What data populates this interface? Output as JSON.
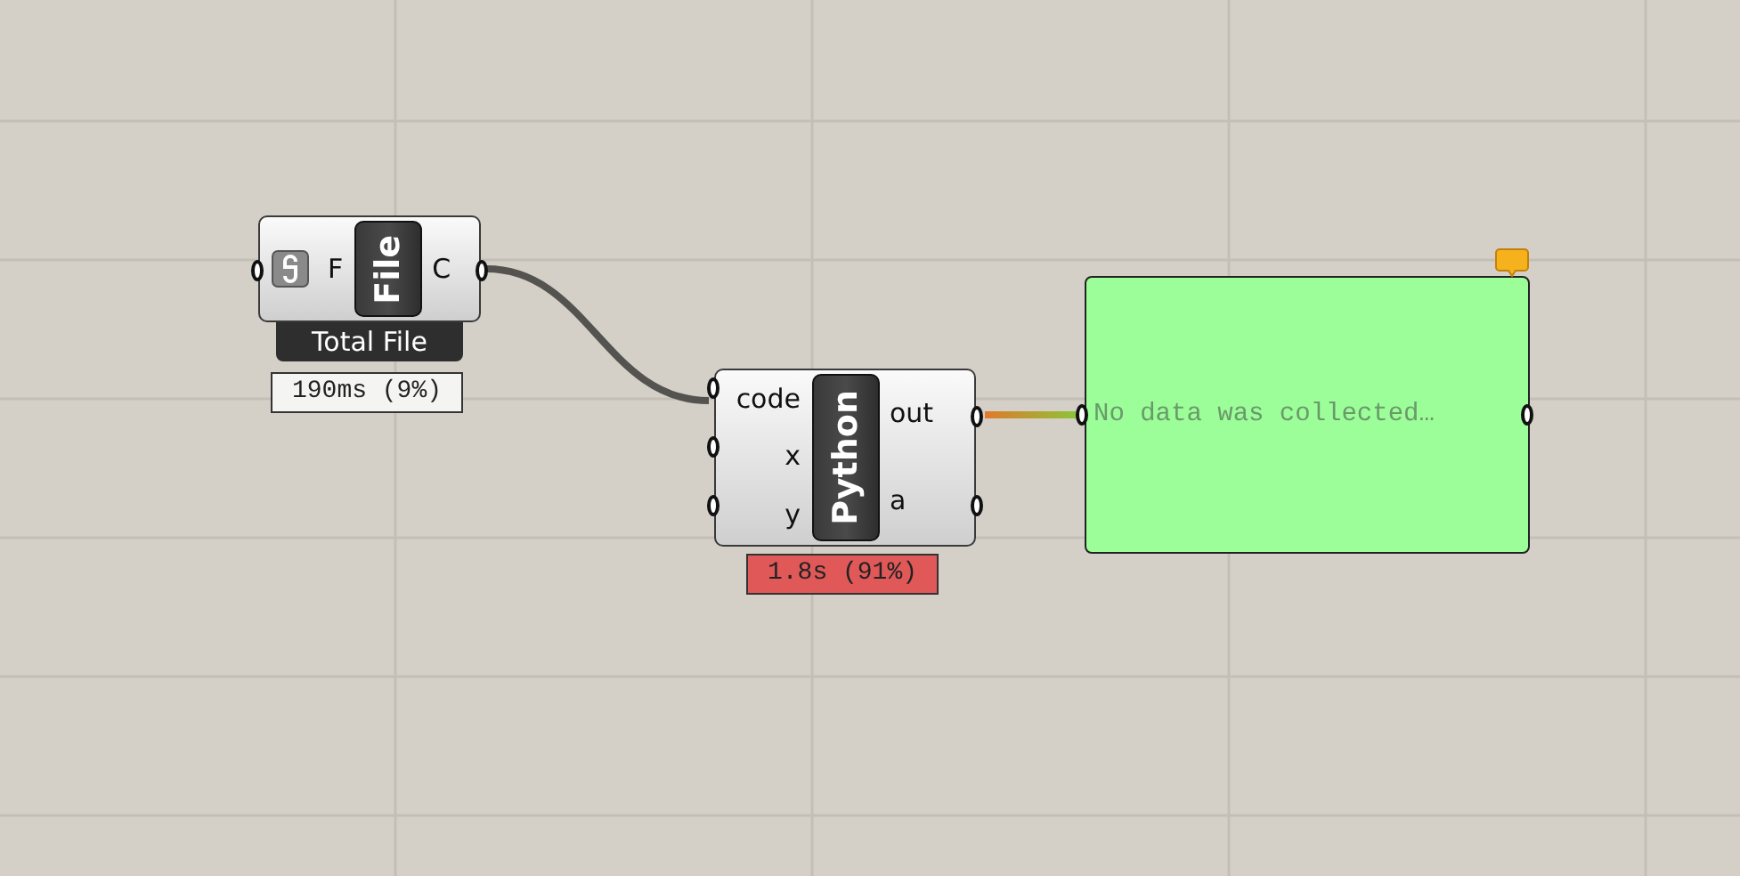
{
  "canvas": {
    "components": [
      {
        "kind": "component",
        "title": "File",
        "inputs": [
          {
            "label": "F",
            "linked": true
          }
        ],
        "outputs": [
          {
            "label": "C"
          }
        ],
        "subtitle": "Total File",
        "profiler": {
          "text": "190ms (9%)",
          "slow": false
        }
      },
      {
        "kind": "component",
        "title": "Python",
        "inputs": [
          {
            "label": "code",
            "linked": false
          },
          {
            "label": "x",
            "linked": false
          },
          {
            "label": "y",
            "linked": false
          }
        ],
        "outputs": [
          {
            "label": "out"
          },
          {
            "label": "a"
          }
        ],
        "profiler": {
          "text": "1.8s (91%)",
          "slow": true
        }
      },
      {
        "kind": "panel",
        "text": "No data was collected…",
        "balloon": true
      }
    ]
  }
}
